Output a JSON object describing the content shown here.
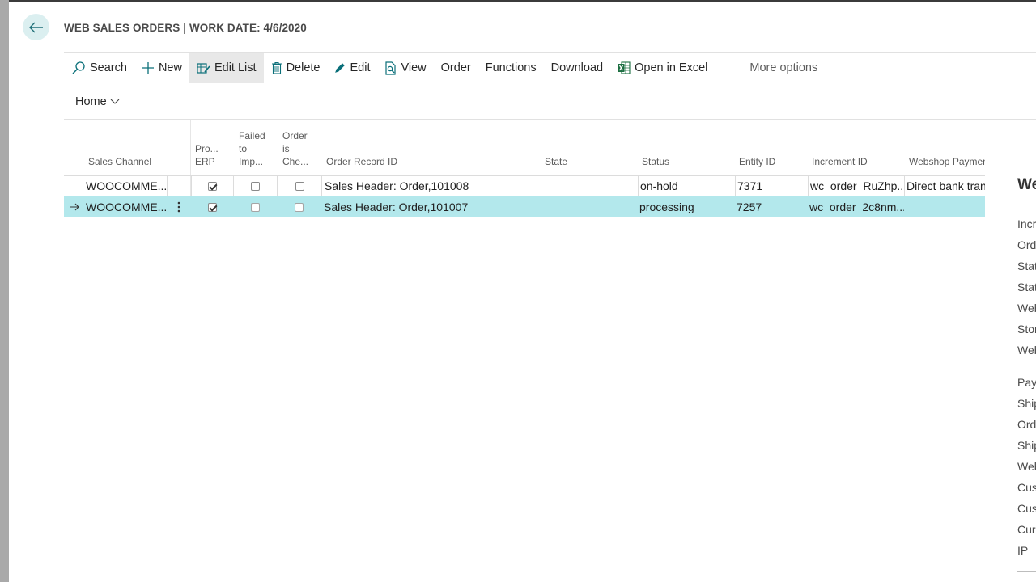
{
  "page": {
    "title": "WEB SALES ORDERS | WORK DATE: 4/6/2020"
  },
  "actions": {
    "search": "Search",
    "new": "New",
    "edit_list": "Edit List",
    "delete": "Delete",
    "edit": "Edit",
    "view": "View",
    "order": "Order",
    "functions": "Functions",
    "download": "Download",
    "open_in_excel": "Open in Excel",
    "more_options": "More options"
  },
  "menu": {
    "home": "Home"
  },
  "columns": {
    "sales_channel": "Sales Channel",
    "processed_erp": [
      "Pro...",
      "ERP"
    ],
    "failed_to_import": [
      "Failed",
      "to",
      "Imp..."
    ],
    "order_is_checked": [
      "Order",
      "is",
      "Che..."
    ],
    "order_record_id": "Order Record ID",
    "state": "State",
    "status": "Status",
    "entity_id": "Entity ID",
    "increment_id": "Increment ID",
    "webshop_payment": "Webshop Paymen"
  },
  "rows": [
    {
      "sales_channel": "WOOCOMME...",
      "processed_erp": true,
      "failed_to_import": false,
      "order_is_checked": false,
      "order_record_id": "Sales Header: Order,101008",
      "state": "",
      "status": "on-hold",
      "entity_id": "7371",
      "increment_id": "wc_order_RuZhp...",
      "webshop_payment": "Direct bank tran",
      "selected": false
    },
    {
      "sales_channel": "WOOCOMME...",
      "processed_erp": true,
      "failed_to_import": false,
      "order_is_checked": false,
      "order_record_id": "Sales Header: Order,101007",
      "state": "",
      "status": "processing",
      "entity_id": "7257",
      "increment_id": "wc_order_2c8nm...",
      "webshop_payment": "",
      "selected": true
    }
  ],
  "factbox": {
    "title": "We",
    "fields": [
      "Incr",
      "Ord",
      "Stat",
      "Stat",
      "Web",
      "Stor",
      "Web",
      "Payr",
      "Ship",
      "Ord",
      "Ship",
      "Web",
      "Cus",
      "Cus",
      "Curr",
      "IP"
    ]
  },
  "colors": {
    "accent": "#00818a",
    "selected_row": "#b3e8ec",
    "back_button_bg": "#dbeff0"
  }
}
